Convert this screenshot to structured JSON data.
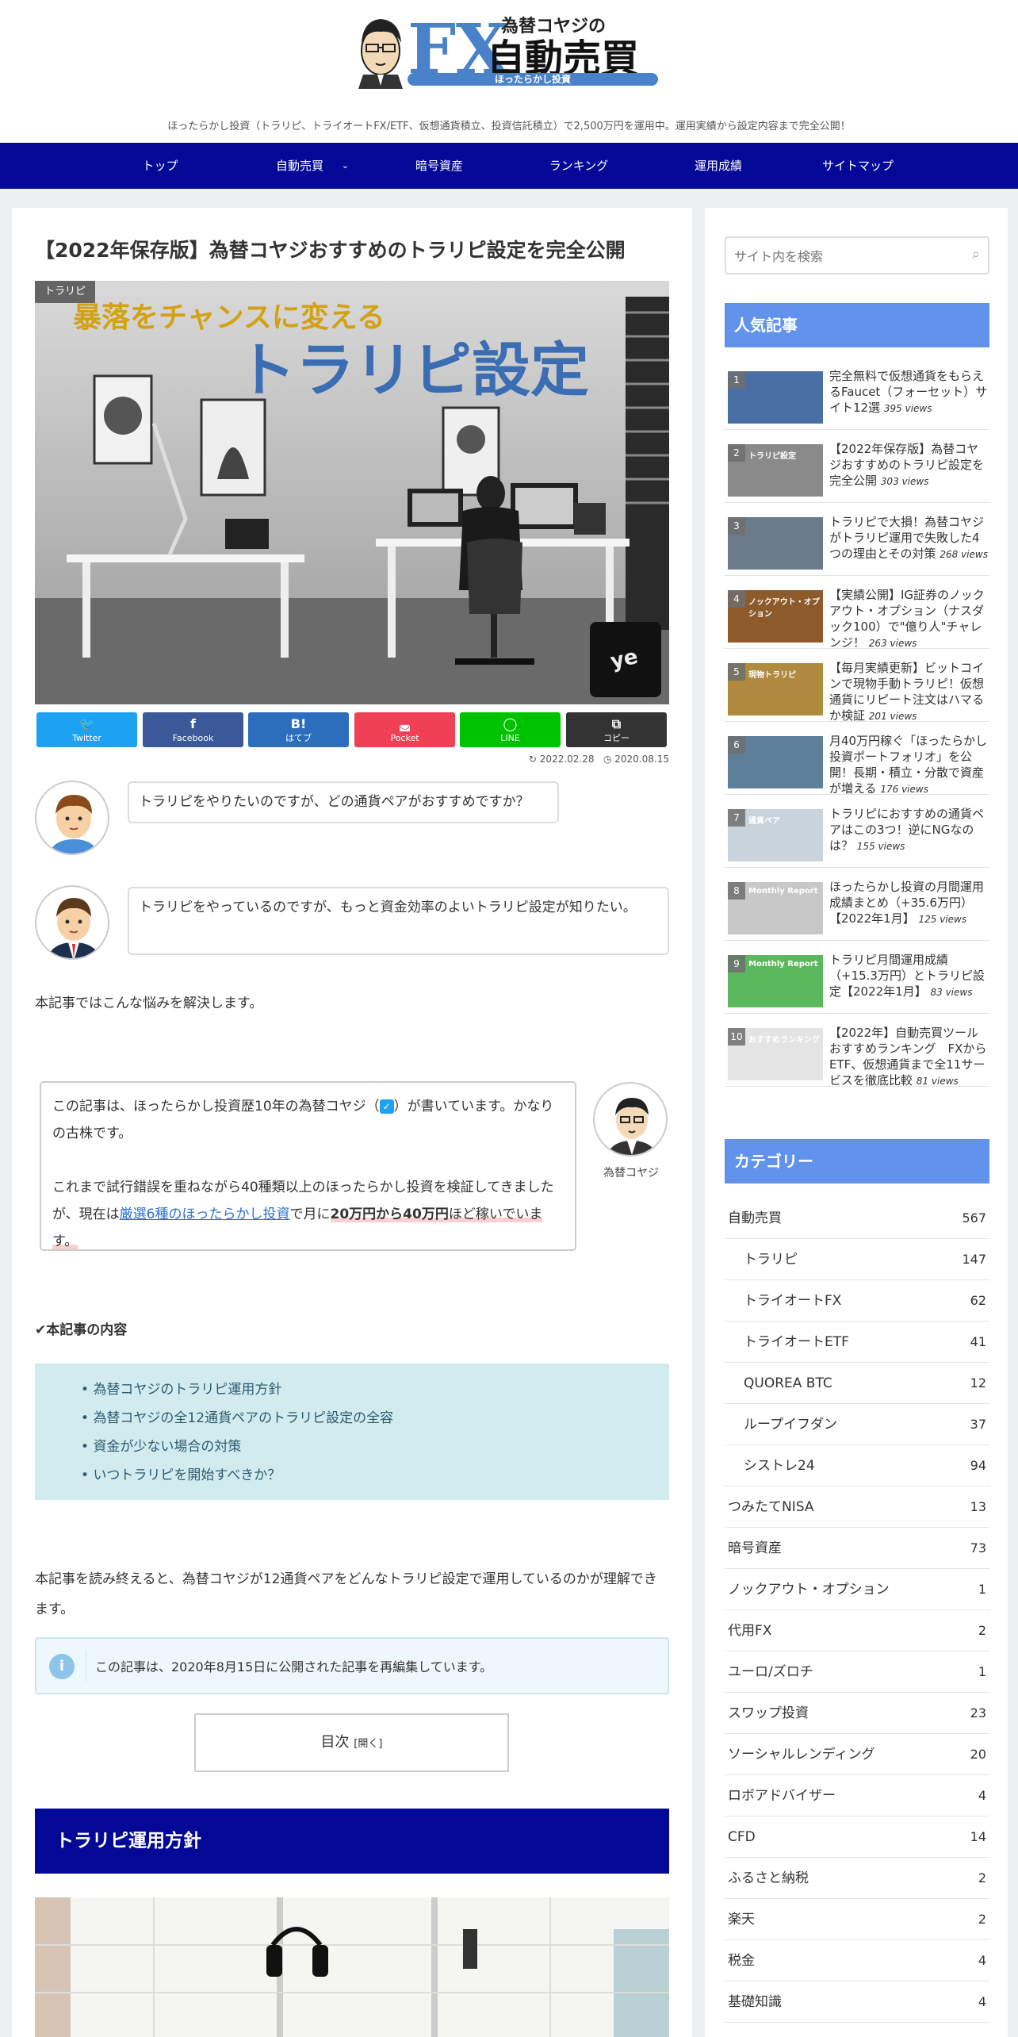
{
  "header": {
    "logo_small": "為替コヤジの",
    "logo_fx": "FX",
    "logo_main": "自動売買",
    "logo_sub": "ほったらかし投資",
    "tagline": "ほったらかし投資（トラリピ、トライオートFX/ETF、仮想通貨積立、投資信託積立）で2,500万円を運用中。運用実績から設定内容まで完全公開！"
  },
  "nav": {
    "items": [
      "トップ",
      "自動売買",
      "暗号資産",
      "ランキング",
      "運用成績",
      "サイトマップ"
    ]
  },
  "article": {
    "title": "【2022年保存版】為替コヤジおすすめのトラリピ設定を完全公開",
    "category": "トラリピ",
    "hero_line1": "暴落をチャンスに変える",
    "hero_line2": "トラリピ設定",
    "share": [
      {
        "label": "Twitter",
        "glyph": "🐦",
        "color": "#1da1f2"
      },
      {
        "label": "Facebook",
        "glyph": "f",
        "color": "#3b5998"
      },
      {
        "label": "はてブ",
        "glyph": "B!",
        "color": "#2c6ebd"
      },
      {
        "label": "Pocket",
        "glyph": "◛",
        "color": "#ef4056"
      },
      {
        "label": "LINE",
        "glyph": "◯",
        "color": "#00c300"
      },
      {
        "label": "コピー",
        "glyph": "⧉",
        "color": "#333333"
      }
    ],
    "updated": "2022.02.28",
    "published": "2020.08.15",
    "bubble1": "トラリピをやりたいのですが、どの通貨ペアがおすすめですか？",
    "bubble2": "トラリピをやっているのですが、もっと資金効率のよいトラリピ設定が知りたい。",
    "intro": "本記事ではこんな悩みを解決します。",
    "author": {
      "line1": "この記事は、ほったらかし投資歴10年の為替コヤジ（",
      "line1b": "）が書いています。かなりの古株です。",
      "line2a": "これまで試行錯誤を重ねながら40種類以上のほったらかし投資を検証してきましたが、現在は",
      "link": "厳選6種のほったらかし投資",
      "line2b": "で月に",
      "bold": "20万円から40万円",
      "line2c": "ほど稼いでいます。",
      "name": "為替コヤジ"
    },
    "toc_heading": "本記事の内容",
    "toc_items": [
      "為替コヤジのトラリピ運用方針",
      "為替コヤジの全12通貨ペアのトラリピ設定の全容",
      "資金が少ない場合の対策",
      "いつトラリピを開始すべきか？"
    ],
    "summary": "本記事を読み終えると、為替コヤジが12通貨ペアをどんなトラリピ設定で運用しているのかが理解できます。",
    "info": "この記事は、2020年8月15日に公開された記事を再編集しています。",
    "toc_button": "目次",
    "toc_open": "[開く]",
    "h2": "トラリピ運用方針"
  },
  "sidebar": {
    "search_placeholder": "サイト内を検索",
    "popular_title": "人気記事",
    "popular": [
      {
        "rank": "1",
        "title": "完全無料で仮想通貨をもらえるFaucet（フォーセット）サイト12選",
        "views": "395 views",
        "color": "#4a6fa5",
        "thumb_text": ""
      },
      {
        "rank": "2",
        "title": "【2022年保存版】為替コヤジおすすめのトラリピ設定を完全公開",
        "views": "303 views",
        "color": "#8a8a8a",
        "thumb_text": "トラリピ設定"
      },
      {
        "rank": "3",
        "title": "トラリピで大損！為替コヤジがトラリピ運用で失敗した4つの理由とその対策",
        "views": "268 views",
        "color": "#6b7b8c",
        "thumb_text": ""
      },
      {
        "rank": "4",
        "title": "【実績公開】IG証券のノックアウト・オプション（ナスダック100）で\"億り人\"チャレンジ！",
        "views": "263 views",
        "color": "#8c5a2b",
        "thumb_text": "ノックアウト・オプション"
      },
      {
        "rank": "5",
        "title": "【毎月実績更新】ビットコインで現物手動トラリピ！仮想通貨にリピート注文はハマるか検証",
        "views": "201 views",
        "color": "#b08a3e",
        "thumb_text": "現物トラリピ"
      },
      {
        "rank": "6",
        "title": "月40万円稼ぐ「ほったらかし投資ポートフォリオ」を公開！長期・積立・分散で資産が増える",
        "views": "176 views",
        "color": "#5d7f9a",
        "thumb_text": ""
      },
      {
        "rank": "7",
        "title": "トラリピにおすすめの通貨ペアはこの3つ！逆にNGなのは？",
        "views": "155 views",
        "color": "#c9d3dc",
        "thumb_text": "通貨ペア"
      },
      {
        "rank": "8",
        "title": "ほったらかし投資の月間運用成績まとめ（+35.6万円）【2022年1月】",
        "views": "125 views",
        "color": "#c8c8c8",
        "thumb_text": "Monthly Report"
      },
      {
        "rank": "9",
        "title": "トラリピ月間運用成績（+15.3万円）とトラリピ設定【2022年1月】",
        "views": "83 views",
        "color": "#5cb85c",
        "thumb_text": "Monthly Report"
      },
      {
        "rank": "10",
        "title": "【2022年】自動売買ツールおすすめランキング　FXからETF、仮想通貨まで全11サービスを徹底比較",
        "views": "81 views",
        "color": "#e4e4e4",
        "thumb_text": "おすすめランキング"
      }
    ],
    "category_title": "カテゴリー",
    "categories": [
      {
        "name": "自動売買",
        "count": "567",
        "sub": false
      },
      {
        "name": "トラリピ",
        "count": "147",
        "sub": true
      },
      {
        "name": "トライオートFX",
        "count": "62",
        "sub": true
      },
      {
        "name": "トライオートETF",
        "count": "41",
        "sub": true
      },
      {
        "name": "QUOREA BTC",
        "count": "12",
        "sub": true
      },
      {
        "name": "ループイフダン",
        "count": "37",
        "sub": true
      },
      {
        "name": "シストレ24",
        "count": "94",
        "sub": true
      },
      {
        "name": "つみたてNISA",
        "count": "13",
        "sub": false
      },
      {
        "name": "暗号資産",
        "count": "73",
        "sub": false
      },
      {
        "name": "ノックアウト・オプション",
        "count": "1",
        "sub": false
      },
      {
        "name": "代用FX",
        "count": "2",
        "sub": false
      },
      {
        "name": "ユーロ/ズロチ",
        "count": "1",
        "sub": false
      },
      {
        "name": "スワップ投資",
        "count": "23",
        "sub": false
      },
      {
        "name": "ソーシャルレンディング",
        "count": "20",
        "sub": false
      },
      {
        "name": "ロボアドバイザー",
        "count": "4",
        "sub": false
      },
      {
        "name": "CFD",
        "count": "14",
        "sub": false
      },
      {
        "name": "ふるさと納税",
        "count": "2",
        "sub": false
      },
      {
        "name": "楽天",
        "count": "2",
        "sub": false
      },
      {
        "name": "税金",
        "count": "4",
        "sub": false
      },
      {
        "name": "基礎知識",
        "count": "4",
        "sub": false
      }
    ]
  }
}
